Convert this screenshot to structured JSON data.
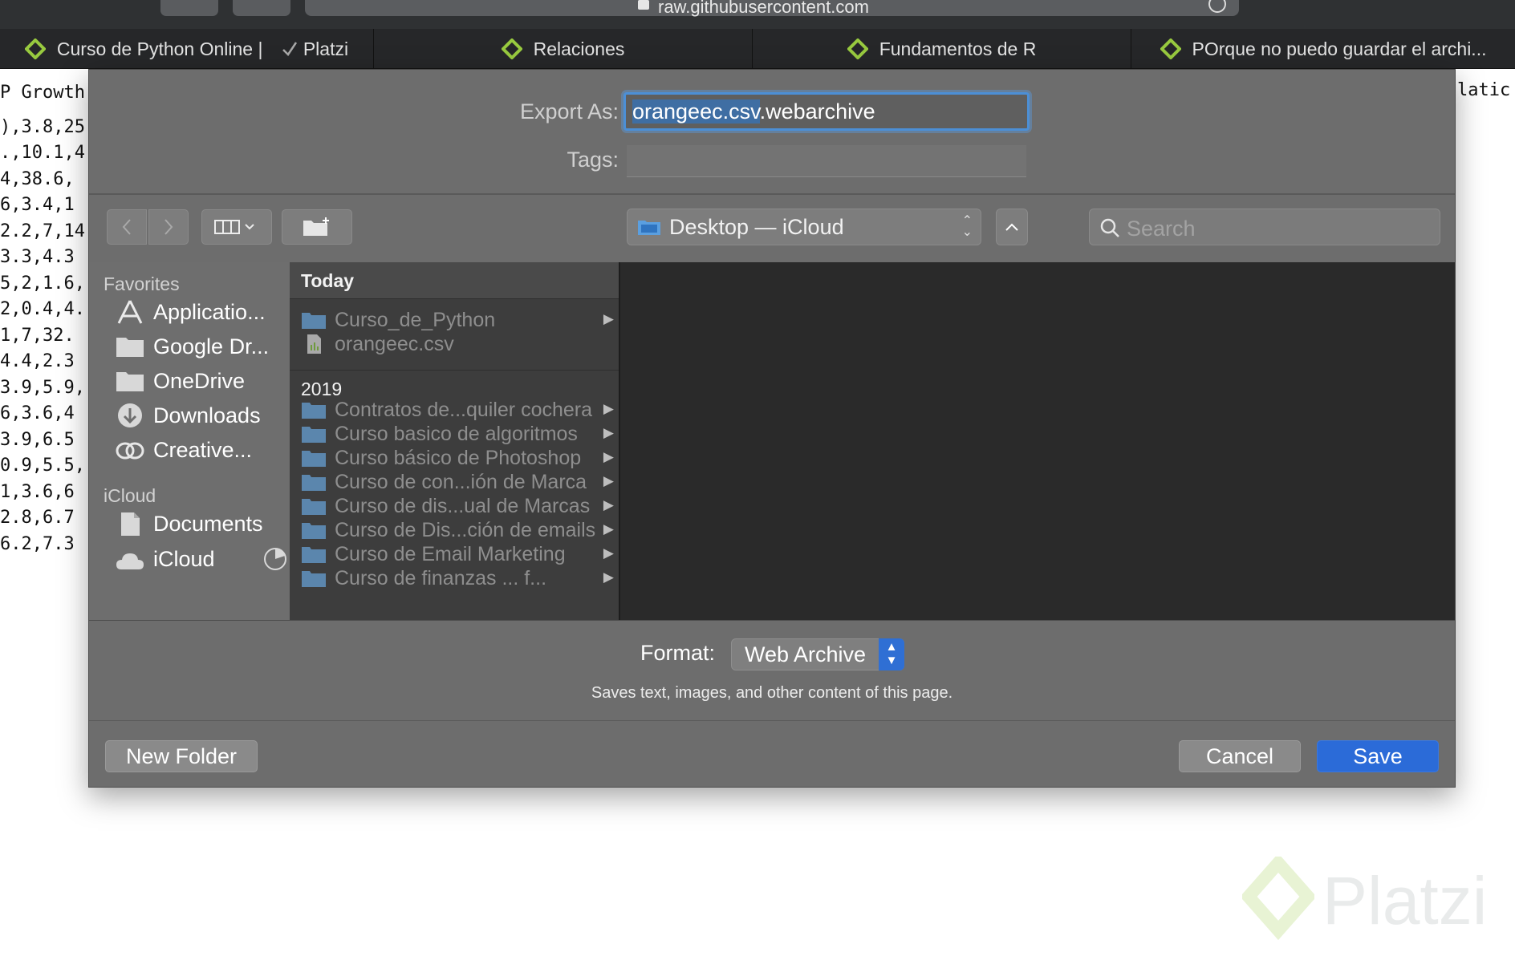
{
  "browser": {
    "url": "raw.githubusercontent.com",
    "tabs": [
      {
        "title": "Curso de Python Online |",
        "suffix": "Platzi"
      },
      {
        "title": "Relaciones"
      },
      {
        "title": "Fundamentos de R"
      },
      {
        "title": "POrque no puedo guardar el archi..."
      }
    ]
  },
  "page": {
    "lines": [
      "P Growth",
      "),3.8,25",
      ".,10.1,4",
      "4,38.6,",
      "6,3.4,1",
      "2.2,7,14",
      "3.3,4.3",
      "5,2,1.6,",
      "2,0.4,4.",
      "1,7,32.",
      "4.4,2.3",
      "3.9,5.9,",
      "6,3.6,4",
      "3.9,6.5",
      "0.9,5.5,",
      "1,3.6,6",
      "2.8,6.7",
      "6.2,7.3"
    ],
    "right_fragment": "latic",
    "watermark": "Platzi"
  },
  "dialog": {
    "export_label": "Export As:",
    "filename_selected": "orangeec.csv",
    "filename_rest": ".webarchive",
    "tags_label": "Tags:",
    "location": "Desktop — iCloud",
    "search_placeholder": "Search",
    "sidebar": {
      "favorites_header": "Favorites",
      "favorites": [
        "Applicatio...",
        "Google Dr...",
        "OneDrive",
        "Downloads",
        "Creative..."
      ],
      "icloud_header": "iCloud",
      "icloud": [
        "Documents",
        "iCloud"
      ]
    },
    "browser": {
      "today_header": "Today",
      "today": [
        {
          "name": "Curso_de_Python",
          "kind": "folder"
        },
        {
          "name": "orangeec.csv",
          "kind": "file"
        }
      ],
      "year_header": "2019",
      "year_items": [
        "Contratos de...quiler cochera",
        "Curso basico de algoritmos",
        "Curso básico de Photoshop",
        "Curso de con...ión de Marca",
        "Curso de dis...ual de Marcas",
        "Curso de Dis...ción de emails",
        "Curso de Email Marketing",
        "Curso de finanzas ... f..."
      ]
    },
    "format_label": "Format:",
    "format_value": "Web Archive",
    "format_description": "Saves text, images, and other content of this page.",
    "new_folder": "New Folder",
    "cancel": "Cancel",
    "save": "Save"
  },
  "colors": {
    "accent": "#2b6bd8",
    "platzi_green": "#98ca3f",
    "folder_blue": "#5b86ad"
  }
}
